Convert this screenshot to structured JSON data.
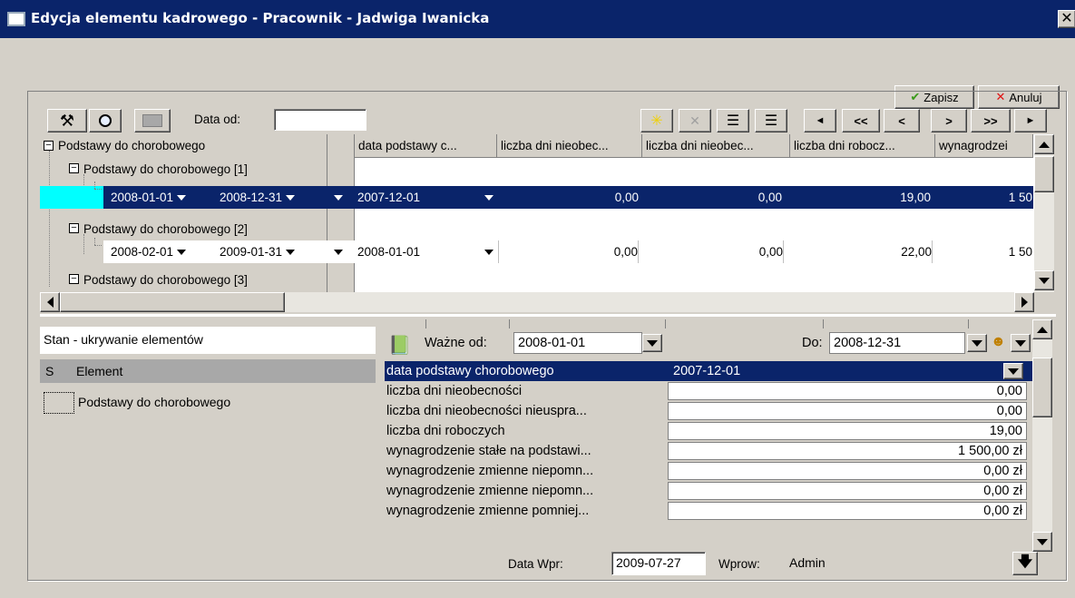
{
  "window": {
    "title": "Edycja elementu kadrowego - Pracownik - Jadwiga Iwanicka",
    "close_glyph": "✕"
  },
  "actions": {
    "save_label": "Zapisz",
    "cancel_label": "Anuluj"
  },
  "toolbar": {
    "date_from_label": "Data od:",
    "date_from_value": "",
    "nav": [
      "◄",
      "<<",
      "<",
      ">",
      ">>",
      "►"
    ]
  },
  "grid": {
    "tree_root": "Podstawy do chorobowego",
    "columns": [
      "data podstawy c...",
      "liczba dni nieobec...",
      "liczba dni nieobec...",
      "liczba dni robocz...",
      "wynagrodzei"
    ],
    "groups": [
      {
        "label": "Podstawy do chorobowego [1]",
        "row": {
          "from": "2008-01-01",
          "to": "2008-12-31",
          "cells": [
            "2007-12-01",
            "0,00",
            "0,00",
            "19,00",
            "1 50"
          ]
        }
      },
      {
        "label": "Podstawy do chorobowego [2]",
        "row": {
          "from": "2008-02-01",
          "to": "2009-01-31",
          "cells": [
            "2008-01-01",
            "0,00",
            "0,00",
            "22,00",
            "1 50"
          ]
        }
      },
      {
        "label": "Podstawy do chorobowego [3]"
      }
    ]
  },
  "state_panel": {
    "title": "Stan - ukrywanie elementów",
    "col_s": "S",
    "col_element": "Element",
    "items": [
      "Podstawy do chorobowego"
    ]
  },
  "details": {
    "valid_from_label": "Ważne od:",
    "valid_from_value": "2008-01-01",
    "to_label": "Do:",
    "to_value": "2008-12-31",
    "rows": [
      {
        "label": "data podstawy chorobowego",
        "value": "2007-12-01"
      },
      {
        "label": "liczba dni nieobecności",
        "value": "0,00"
      },
      {
        "label": "liczba dni nieobecności nieuspra...",
        "value": "0,00"
      },
      {
        "label": "liczba dni roboczych",
        "value": "19,00"
      },
      {
        "label": "wynagrodzenie stałe na podstawi...",
        "value": "1 500,00 zł"
      },
      {
        "label": "wynagrodzenie zmienne niepomn...",
        "value": "0,00 zł"
      },
      {
        "label": "wynagrodzenie zmienne niepomn...",
        "value": "0,00 zł"
      },
      {
        "label": "wynagrodzenie zmienne pomniej...",
        "value": "0,00 zł"
      }
    ],
    "entry_date_label": "Data Wpr:",
    "entry_date_value": "2009-07-27",
    "entered_by_label": "Wprow:",
    "entered_by_value": "Admin"
  },
  "colors": {
    "selection": "#0a246a",
    "highlight": "#00ffff",
    "face": "#d4d0c8"
  }
}
